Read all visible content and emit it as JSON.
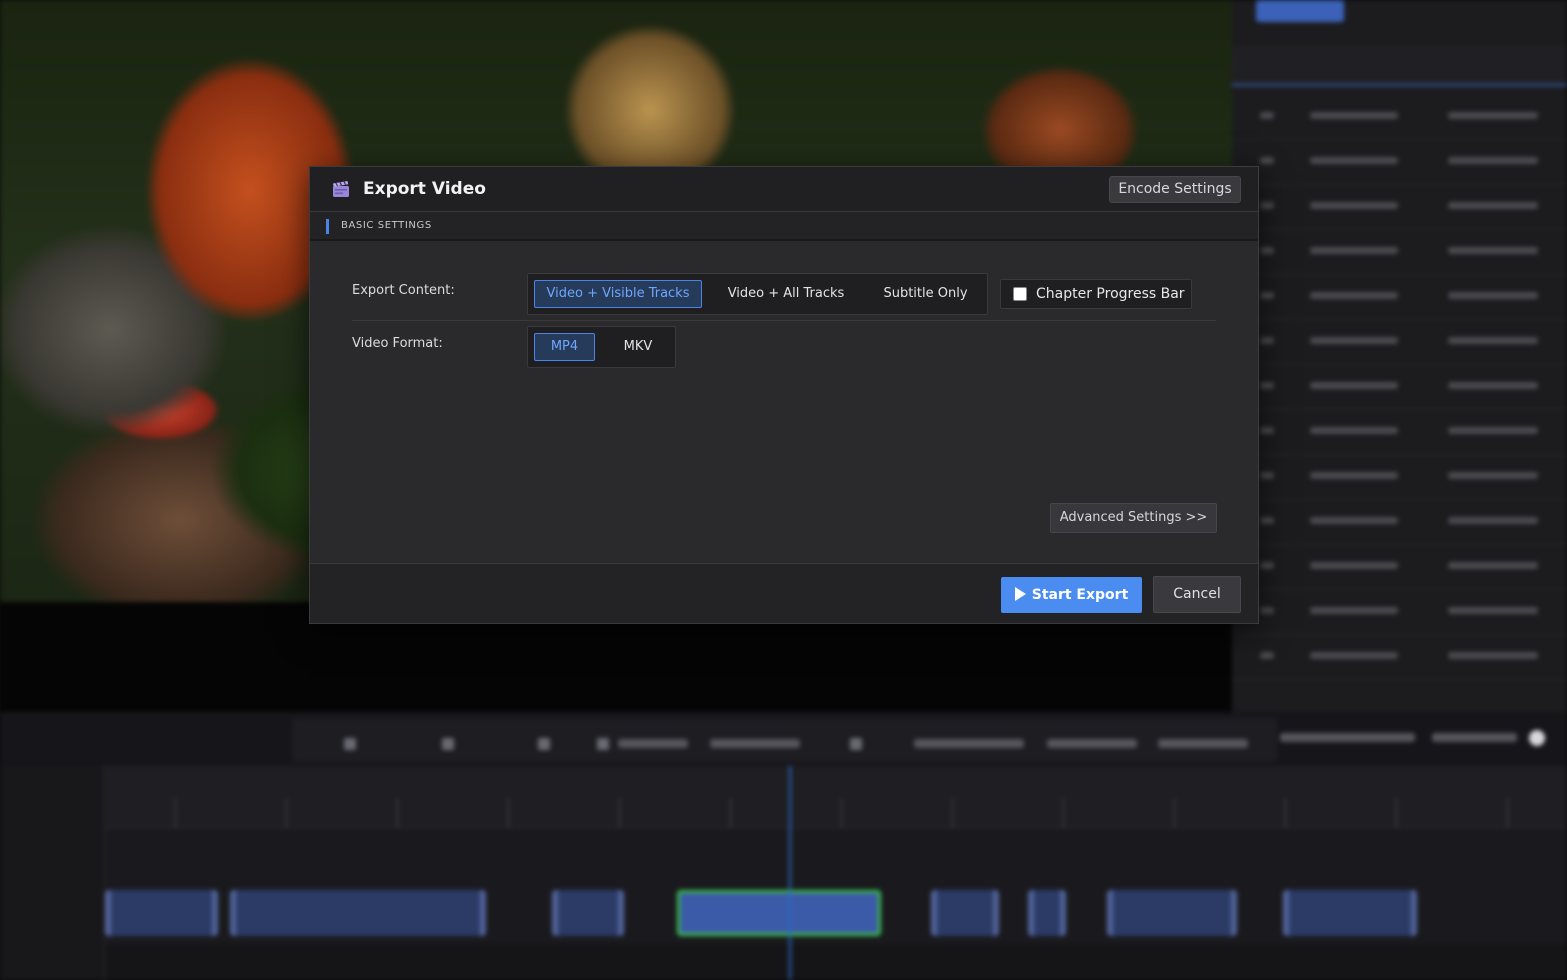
{
  "dialog": {
    "title": "Export Video",
    "icon": "clapperboard-icon",
    "encode_settings_label": "Encode Settings",
    "section_title": "BASIC SETTINGS",
    "export_content": {
      "label": "Export Content:",
      "options": [
        "Video + Visible Tracks",
        "Video + All Tracks",
        "Subtitle Only"
      ],
      "selected": "Video + Visible Tracks"
    },
    "chapter_progress_bar": {
      "label": "Chapter Progress Bar",
      "checked": false
    },
    "video_format": {
      "label": "Video Format:",
      "options": [
        "MP4",
        "MKV"
      ],
      "selected": "MP4"
    },
    "advanced_settings_label": "Advanced Settings >>",
    "start_export_label": "Start Export",
    "cancel_label": "Cancel"
  },
  "colors": {
    "accent": "#4a8cf0",
    "selected_border": "#4a84e8",
    "selected_text": "#6ea6ff",
    "dialog_bg": "#2a2a2d"
  }
}
